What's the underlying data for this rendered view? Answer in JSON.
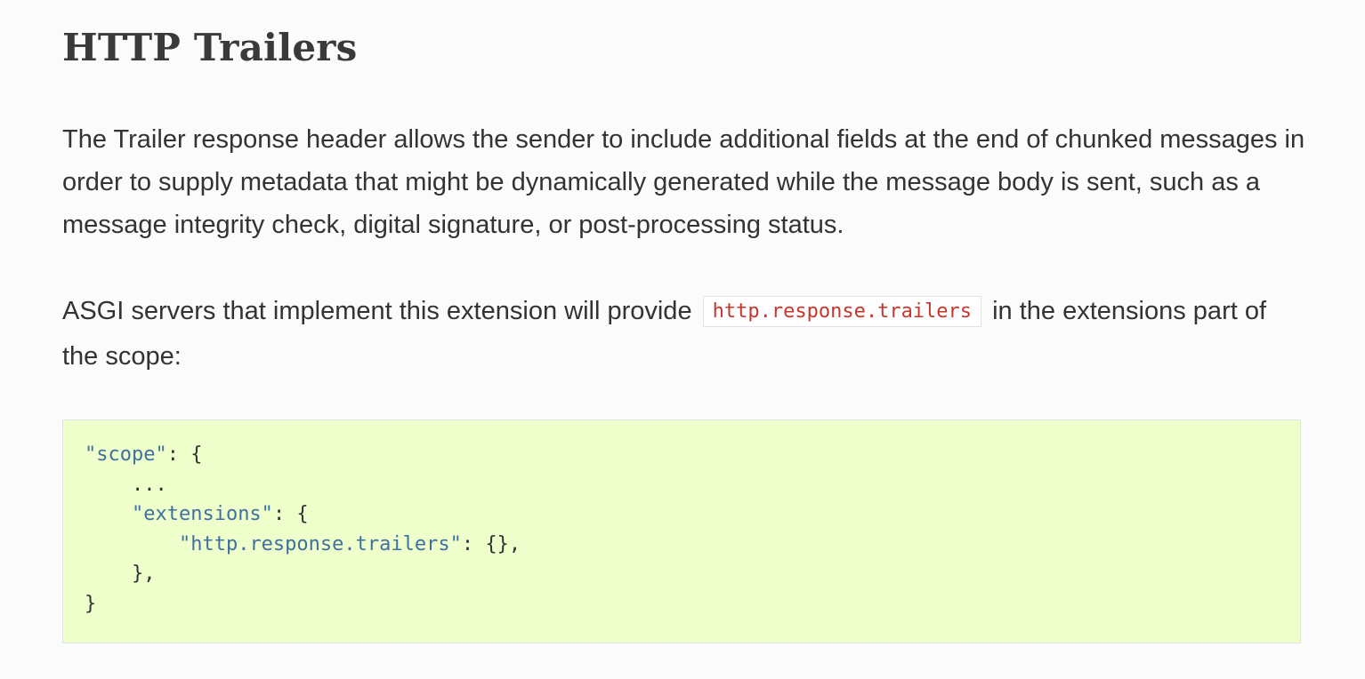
{
  "heading": "HTTP Trailers",
  "paragraph1": "The Trailer response header allows the sender to include additional fields at the end of chunked messages in order to supply metadata that might be dynamically generated while the message body is sent, such as a message integrity check, digital signature, or post-processing status.",
  "paragraph2": {
    "before": "ASGI servers that implement this extension will provide",
    "code": "http.response.trailers",
    "after": "in the extensions part of the scope:"
  },
  "code_block": {
    "line1_key": "\"scope\"",
    "line1_rest": ": {",
    "line2": "    ...",
    "line3_indent": "    ",
    "line3_key": "\"extensions\"",
    "line3_rest": ": {",
    "line4_indent": "        ",
    "line4_key": "\"http.response.trailers\"",
    "line4_rest": ": {},",
    "line5": "    },",
    "line6": "}"
  },
  "colors": {
    "code_background": "#eeffcc",
    "string_token": "#4070a0",
    "inline_code_text": "#c7362b"
  }
}
